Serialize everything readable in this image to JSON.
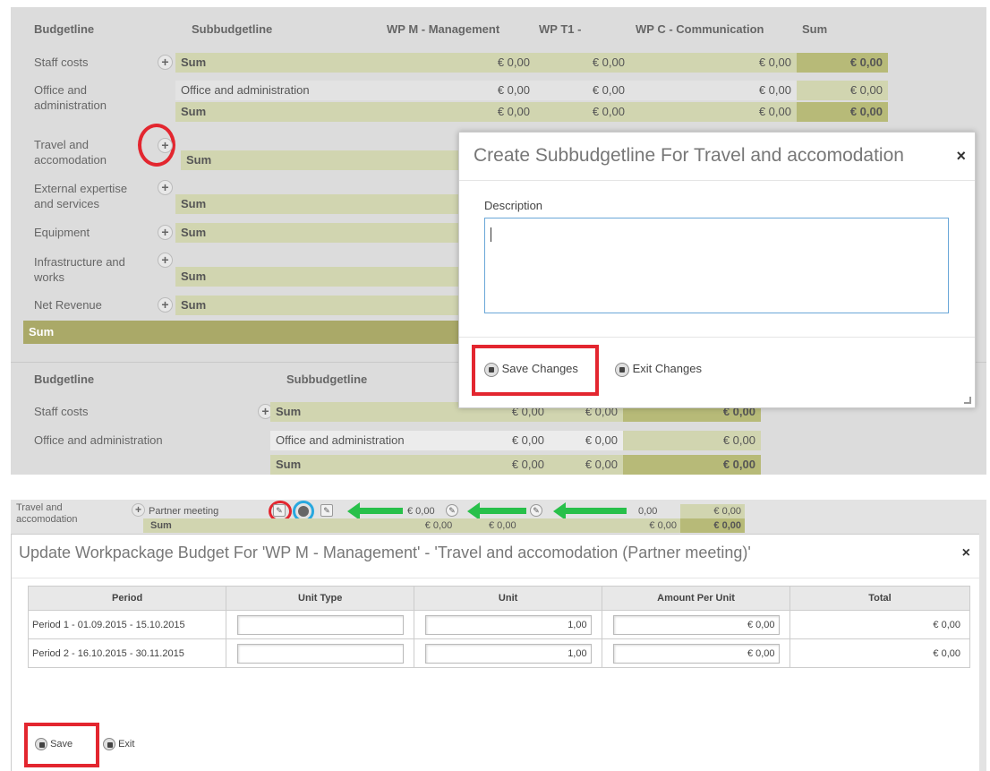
{
  "top_table": {
    "headers": {
      "budgetline": "Budgetline",
      "subbudgetline": "Subbudgetline",
      "wp_m": "WP M - Management",
      "wp_t1": "WP T1 -",
      "wp_c": "WP C - Communication",
      "sum": "Sum"
    },
    "rows": {
      "staff": {
        "label": "Staff costs",
        "sub": "Sum",
        "wp_m": "€ 0,00",
        "wp_t1": "€ 0,00",
        "wp_c": "€ 0,00",
        "sum": "€ 0,00"
      },
      "office_line1": "Office and",
      "office_line2": "administration",
      "office_sub": "Office and administration",
      "office_sub_vals": {
        "wp_m": "€ 0,00",
        "wp_t1": "€ 0,00",
        "wp_c": "€ 0,00",
        "sum": "€ 0,00"
      },
      "office_sum": {
        "sub": "Sum",
        "wp_m": "€ 0,00",
        "wp_t1": "€ 0,00",
        "wp_c": "€ 0,00",
        "sum": "€ 0,00"
      },
      "travel_line1": "Travel and",
      "travel_line2": "accomodation",
      "travel_sum": "Sum",
      "external_line1": "External expertise",
      "external_line2": "and services",
      "external_sum": "Sum",
      "equipment": "Equipment",
      "equipment_sum": "Sum",
      "infra_line1": "Infrastructure and",
      "infra_line2": "works",
      "infra_sum": "Sum",
      "net": "Net Revenue",
      "net_sum": "Sum",
      "total": "Sum"
    }
  },
  "create_modal": {
    "title": "Create Subbudgetline For Travel and accomodation",
    "close": "×",
    "description_label": "Description",
    "description_value": "",
    "save_label": "Save Changes",
    "exit_label": "Exit Changes"
  },
  "lower_table": {
    "headers": {
      "budgetline": "Budgetline",
      "subbudgetline": "Subbudgetline"
    },
    "staff": {
      "label": "Staff costs",
      "sub": "Sum",
      "v1": "€ 0,00",
      "v2": "€ 0,00",
      "sum": "€ 0,00"
    },
    "office": {
      "label": "Office and administration",
      "sub": "Office and administration",
      "v1": "€ 0,00",
      "v2": "€ 0,00",
      "sum": "€ 0,00"
    },
    "office_sum": {
      "sub": "Sum",
      "v1": "€ 0,00",
      "v2": "€ 0,00",
      "sum": "€ 0,00"
    }
  },
  "bottom_strip": {
    "travel_line1": "Travel and",
    "travel_line2": "accomodation",
    "partner": "Partner meeting",
    "sum": "Sum",
    "row1": {
      "a": "€ 0,00",
      "b": "0,00",
      "c": "€ 0,00"
    },
    "row2": {
      "a": "€ 0,00",
      "b": "€ 0,00",
      "c": "€ 0,00",
      "d": "€ 0,00"
    }
  },
  "update_modal": {
    "title": "Update Workpackage Budget For 'WP M - Management' - 'Travel and accomodation (Partner meeting)'",
    "close": "×",
    "columns": [
      "Period",
      "Unit Type",
      "Unit",
      "Amount Per Unit",
      "Total"
    ],
    "rows": [
      {
        "period": "Period 1 - 01.09.2015 - 15.10.2015",
        "unit_type": "",
        "unit": "1,00",
        "amount": "€ 0,00",
        "total": "€ 0,00"
      },
      {
        "period": "Period 2 - 16.10.2015 - 30.11.2015",
        "unit_type": "",
        "unit": "1,00",
        "amount": "€ 0,00",
        "total": "€ 0,00"
      }
    ],
    "save_label": "Save",
    "exit_label": "Exit"
  },
  "colors": {
    "sum_light": "#d1d5b0",
    "sum_dark": "#b7ba78",
    "highlight_red": "#e3262f",
    "highlight_blue": "#28a8df",
    "arrow_green": "#28c04a"
  }
}
